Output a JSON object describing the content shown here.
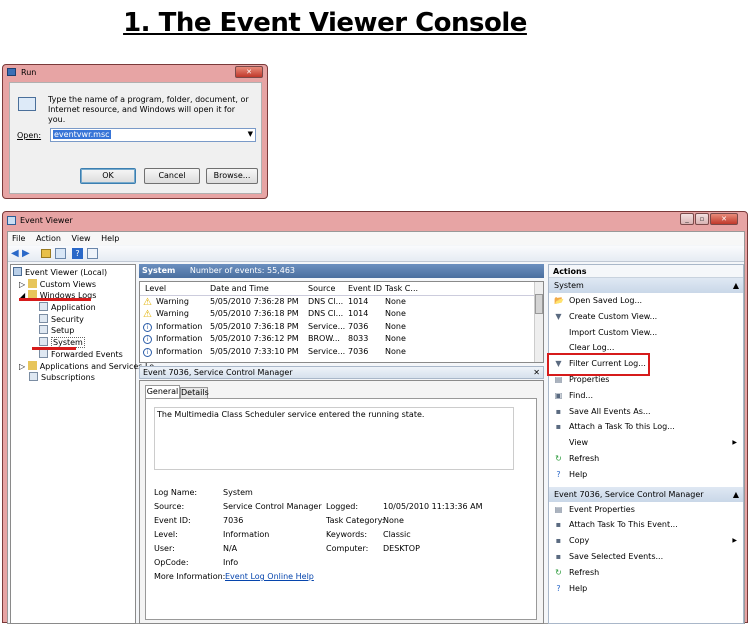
{
  "heading": "1. The Event Viewer Console",
  "run": {
    "title": "Run",
    "desc": "Type the name of a program, folder, document, or Internet resource, and Windows will open it for you.",
    "open_label": "Open:",
    "open_value": "eventvwr.msc",
    "ok": "OK",
    "cancel": "Cancel",
    "browse": "Browse..."
  },
  "ev": {
    "title": "Event Viewer",
    "menu": [
      "File",
      "Action",
      "View",
      "Help"
    ],
    "tree": [
      "Event Viewer (Local)",
      "Custom Views",
      "Windows Logs",
      "Application",
      "Security",
      "Setup",
      "System",
      "Forwarded Events",
      "Applications and Services Lo",
      "Subscriptions"
    ],
    "center_title": "System",
    "center_count": "Number of events: 55,463",
    "cols": [
      "Level",
      "Date and Time",
      "Source",
      "Event ID",
      "Task C..."
    ],
    "rows": [
      [
        "Warning",
        "5/05/2010 7:36:28 PM",
        "DNS Cl...",
        "1014",
        "None"
      ],
      [
        "Warning",
        "5/05/2010 7:36:18 PM",
        "DNS Cl...",
        "1014",
        "None"
      ],
      [
        "Information",
        "5/05/2010 7:36:18 PM",
        "Service...",
        "7036",
        "None"
      ],
      [
        "Information",
        "5/05/2010 7:36:12 PM",
        "BROW...",
        "8033",
        "None"
      ],
      [
        "Information",
        "5/05/2010 7:33:10 PM",
        "Service...",
        "7036",
        "None"
      ]
    ],
    "detail_title": "Event 7036, Service Control Manager",
    "tab_general": "General",
    "tab_details": "Details",
    "message": "The Multimedia Class Scheduler service entered the running state.",
    "props": {
      "log_name_l": "Log Name:",
      "log_name": "System",
      "source_l": "Source:",
      "source": "Service Control Manager",
      "logged_l": "Logged:",
      "logged": "10/05/2010 11:13:36 AM",
      "event_id_l": "Event ID:",
      "event_id": "7036",
      "task_l": "Task Category:",
      "task": "None",
      "level_l": "Level:",
      "level": "Information",
      "keywords_l": "Keywords:",
      "keywords": "Classic",
      "user_l": "User:",
      "user": "N/A",
      "computer_l": "Computer:",
      "computer": "DESKTOP",
      "opcode_l": "OpCode:",
      "opcode": "Info",
      "more_l": "More Information:",
      "more": "Event Log Online Help"
    },
    "actions_title": "Actions",
    "sec1": "System",
    "actions1": [
      "Open Saved Log...",
      "Create Custom View...",
      "Import Custom View...",
      "Clear Log...",
      "Filter Current Log...",
      "Properties",
      "Find...",
      "Save All Events As...",
      "Attach a Task To this Log...",
      "View",
      "Refresh",
      "Help"
    ],
    "sec2": "Event 7036, Service Control Manager",
    "actions2": [
      "Event Properties",
      "Attach Task To This Event...",
      "Copy",
      "Save Selected Events...",
      "Refresh",
      "Help"
    ]
  }
}
